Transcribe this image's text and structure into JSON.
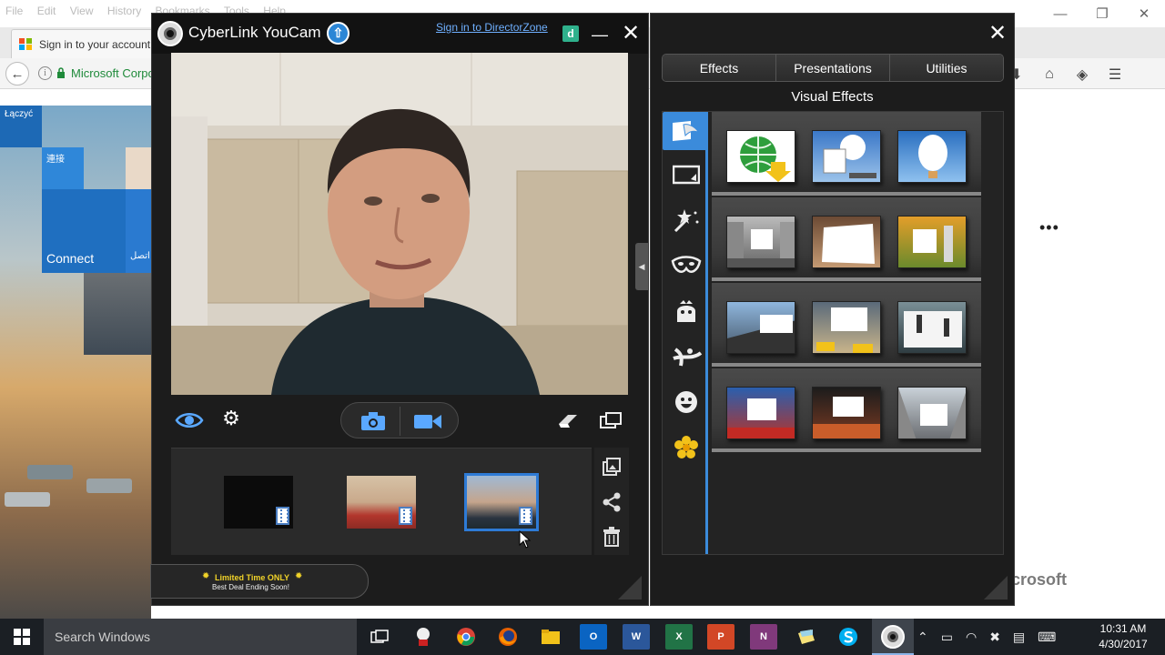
{
  "browser": {
    "menu": [
      "File",
      "Edit",
      "View",
      "History",
      "Bookmarks",
      "Tools",
      "Help"
    ],
    "tab_title": "Sign in to your account",
    "url_org": "Microsoft Corpo",
    "window_controls": [
      "minimize",
      "maximize",
      "close"
    ],
    "nav_icons": [
      "download-icon",
      "home-icon",
      "extension-icon",
      "hamburger-menu-icon"
    ],
    "page": {
      "tiles": [
        "Łączyć",
        "連接",
        "Connect",
        "اتصل"
      ],
      "more_dots": "•••",
      "footer_brand": "icrosoft"
    }
  },
  "youcam": {
    "app_name": "CyberLink YouCam",
    "signin_link": "Sign in to DirectorZone",
    "dz_badge": "d",
    "controls": {
      "eye_icon": "eye-icon",
      "settings_icon": "gear-icon",
      "capture_icons": [
        "camera-icon",
        "video-camera-icon"
      ],
      "right_icons": [
        "eraser-icon",
        "window-mode-icon"
      ]
    },
    "thumbnails": [
      {
        "label": "dark clip",
        "selected": false
      },
      {
        "label": "red shirt clip",
        "selected": false
      },
      {
        "label": "blue clip",
        "selected": true
      }
    ],
    "thumb_actions": [
      "album-icon",
      "share-icon",
      "trash-icon"
    ],
    "promo": {
      "line1": "Limited Time ONLY",
      "line2": "Best Deal Ending Soon!"
    }
  },
  "effects_panel": {
    "tabs": [
      "Effects",
      "Presentations",
      "Utilities"
    ],
    "title": "Visual Effects",
    "categories": [
      "scene-icon",
      "frame-icon",
      "particle-icon",
      "mask-icon",
      "avatar-icon",
      "distortion-icon",
      "emotion-icon",
      "gadget-icon"
    ],
    "active_category": 0
  },
  "taskbar": {
    "search_placeholder": "Search Windows",
    "apps": [
      "task-view-icon",
      "cortana-icon",
      "chrome-icon",
      "firefox-icon",
      "file-explorer-icon",
      "outlook-icon",
      "word-icon",
      "excel-icon",
      "powerpoint-icon",
      "onenote-icon",
      "sticky-notes-icon",
      "skype-icon",
      "youcam-icon"
    ],
    "app_letters": {
      "outlook": "O",
      "word": "W",
      "excel": "X",
      "powerpoint": "P",
      "onenote": "N"
    },
    "time": "10:31 AM",
    "date": "4/30/2017"
  },
  "colors": {
    "accent_blue": "#3b8bdb",
    "link_blue": "#6fb0ff",
    "promo_yellow": "#f0d229"
  }
}
